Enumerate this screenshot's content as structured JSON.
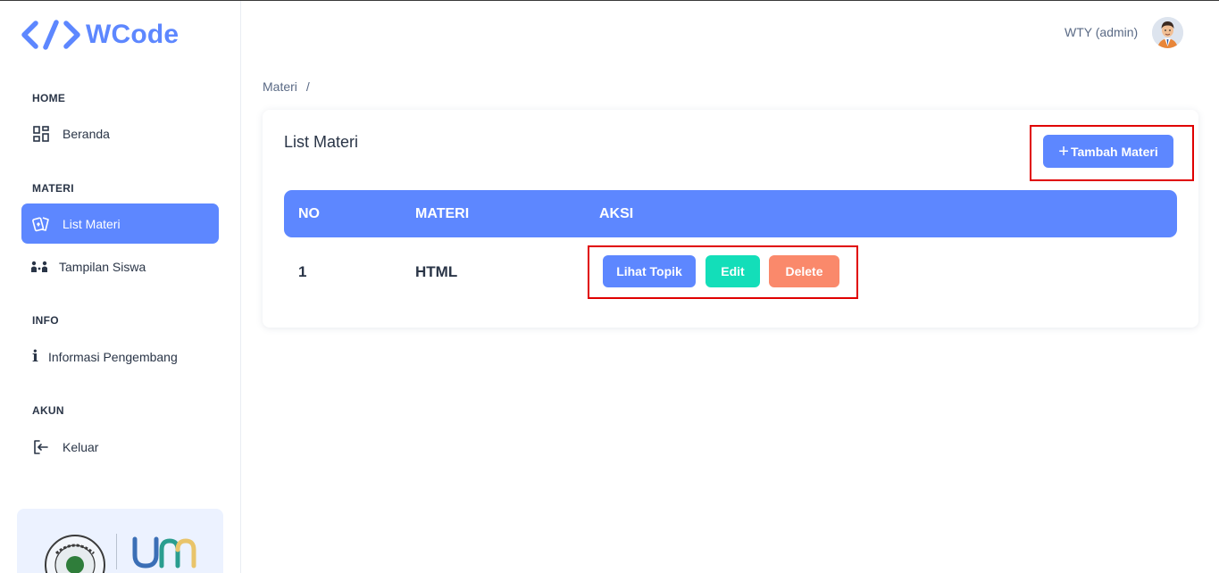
{
  "app": {
    "name": "WCode",
    "brand_color": "#5d87ff"
  },
  "sidebar": {
    "sections": [
      {
        "caption": "HOME",
        "items": [
          {
            "label": "Beranda",
            "icon": "dashboard-grid-icon"
          }
        ]
      },
      {
        "caption": "MATERI",
        "items": [
          {
            "label": "List Materi",
            "icon": "cards-icon",
            "active": true
          },
          {
            "label": "Tampilan Siswa",
            "icon": "users-icon"
          }
        ]
      },
      {
        "caption": "INFO",
        "items": [
          {
            "label": "Informasi Pengembang",
            "icon": "info-icon"
          }
        ]
      },
      {
        "caption": "AKUN",
        "items": [
          {
            "label": "Keluar",
            "icon": "logout-icon"
          }
        ]
      }
    ],
    "promo": {
      "left_logo": "university-seal-logo",
      "right_logo": "um-logo"
    }
  },
  "header": {
    "user_label": "WTY (admin)",
    "avatar": "user-avatar"
  },
  "breadcrumb": {
    "current": "Materi",
    "separator": "/"
  },
  "card": {
    "title": "List Materi",
    "add_button": "Tambah Materi",
    "table": {
      "columns": [
        "NO",
        "MATERI",
        "AKSI"
      ],
      "rows": [
        {
          "no": "1",
          "materi": "HTML",
          "actions": [
            "Lihat Topik",
            "Edit",
            "Delete"
          ]
        }
      ]
    }
  },
  "colors": {
    "primary": "#5d87ff",
    "success": "#13deb9",
    "danger": "#fa896b",
    "highlight": "#e00000"
  }
}
